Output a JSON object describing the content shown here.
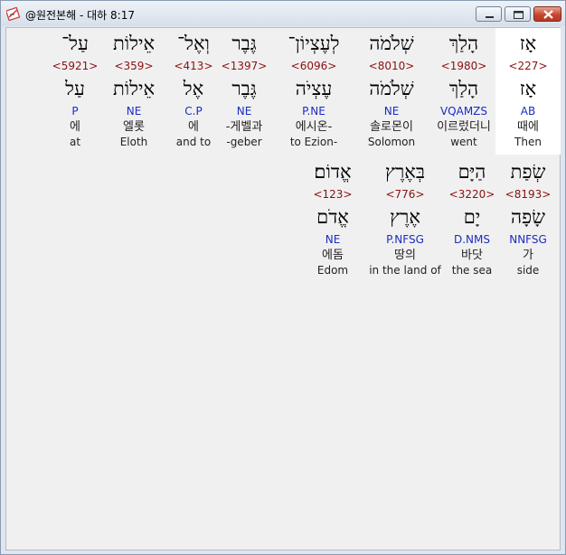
{
  "window": {
    "title": "@원전본해 - 대하 8:17",
    "icon": "bible-app-icon",
    "close_color": "#c8462f"
  },
  "colors": {
    "strong": "#8b1010",
    "morph": "#1c2bc2",
    "text": "#222222"
  },
  "rows": [
    [
      {
        "heb": "אָז",
        "strong": "<227>",
        "lemma": "אָז",
        "morph": "AB",
        "kor": "때에",
        "eng": "Then",
        "selected": true
      },
      {
        "heb": "הָלַךְ",
        "strong": "<1980>",
        "lemma": "הָלַךְ",
        "morph": "VQAMZS",
        "kor": "이르렀더니",
        "eng": "went"
      },
      {
        "heb": "שְׁלֹמֹה",
        "strong": "<8010>",
        "lemma": "שְׁלֹמֹה",
        "morph": "NE",
        "kor": "솔로몬이",
        "eng": "Solomon"
      },
      {
        "heb": "לְעֶצְיוֹן־",
        "strong": "<6096>",
        "lemma": "עֶצְיֹה",
        "morph": "P.NE",
        "kor": "에시온-",
        "eng": "to Ezion-"
      },
      {
        "heb": "גֶּבֶר",
        "strong": "<1397>",
        "lemma": "גֶּבֶר",
        "morph": "NE",
        "kor": "-게벨과",
        "eng": "-geber"
      },
      {
        "heb": "וְאֶל־",
        "strong": "<413>",
        "lemma": "אֶל",
        "morph": "C.P",
        "kor": "에",
        "eng": "and to"
      },
      {
        "heb": "אֵילוֹת",
        "strong": "<359>",
        "lemma": "אֵילוֹת",
        "morph": "NE",
        "kor": "엘롯",
        "eng": "Eloth"
      },
      {
        "heb": "עַל־",
        "strong": "<5921>",
        "lemma": "עַל",
        "morph": "P",
        "kor": "에",
        "eng": "at"
      }
    ],
    [
      {
        "heb": "שְׂפַת",
        "strong": "<8193>",
        "lemma": "שָׂפָה",
        "morph": "NNFSG",
        "kor": "가",
        "eng": "side"
      },
      {
        "heb": "הַיָּם",
        "strong": "<3220>",
        "lemma": "יָם",
        "morph": "D.NMS",
        "kor": "바닷",
        "eng": "the sea"
      },
      {
        "heb": "בְּאֶרֶץ",
        "strong": "<776>",
        "lemma": "אֶרֶץ",
        "morph": "P.NFSG",
        "kor": "땅의",
        "eng": "in the land of"
      },
      {
        "heb": "אֱדוֹם׃",
        "strong": "<123>",
        "lemma": "אֱדֹם",
        "morph": "NE",
        "kor": "에돔",
        "eng": "Edom"
      }
    ]
  ]
}
